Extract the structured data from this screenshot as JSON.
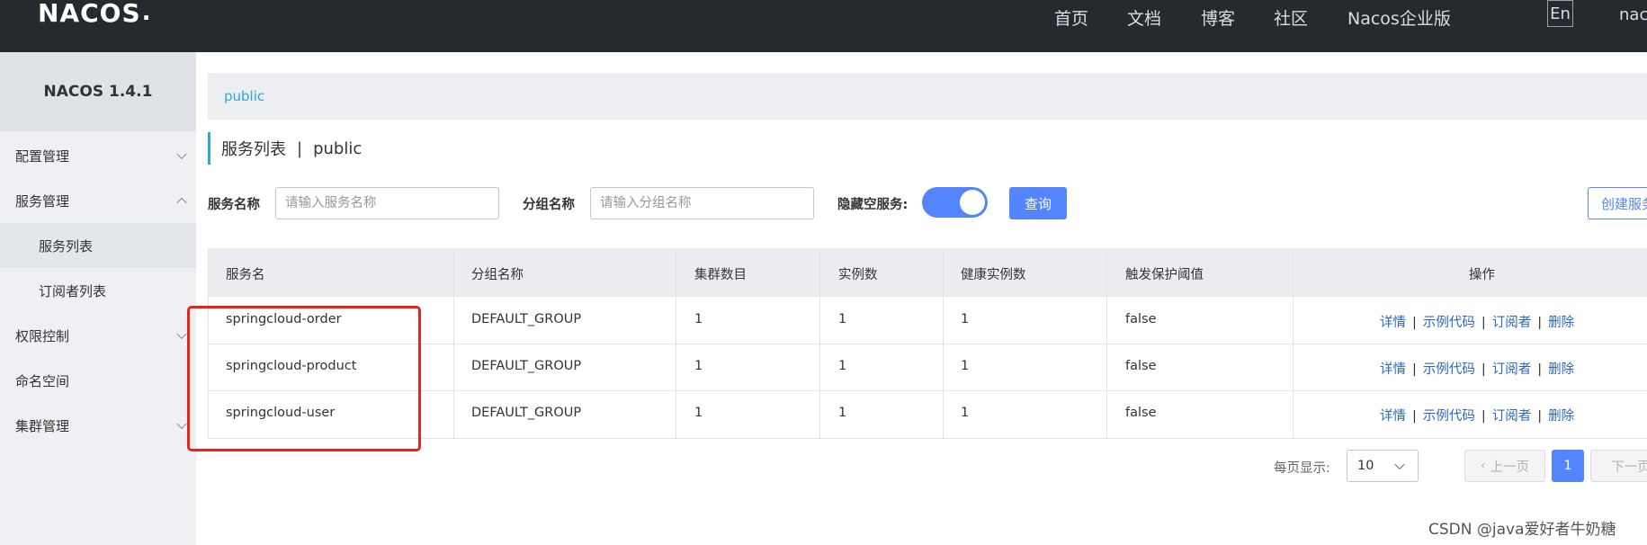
{
  "header": {
    "logo": "NACOS",
    "nav": [
      "首页",
      "文档",
      "博客",
      "社区",
      "Nacos企业版"
    ],
    "lang": "En",
    "user": "nacos"
  },
  "sidebar": {
    "title": "NACOS 1.4.1",
    "items": [
      {
        "label": "配置管理"
      },
      {
        "label": "服务管理"
      },
      {
        "label": "服务列表"
      },
      {
        "label": "订阅者列表"
      },
      {
        "label": "权限控制"
      },
      {
        "label": "命名空间"
      },
      {
        "label": "集群管理"
      }
    ]
  },
  "breadcrumb": {
    "namespace": "public"
  },
  "page_title": {
    "title": "服务列表",
    "sep": "|",
    "namespace": "public"
  },
  "filters": {
    "service_name_label": "服务名称",
    "service_name_placeholder": "请输入服务名称",
    "group_name_label": "分组名称",
    "group_name_placeholder": "请输入分组名称",
    "hide_empty_label": "隐藏空服务:",
    "query_label": "查询",
    "create_label": "创建服务"
  },
  "table": {
    "headers": [
      "服务名",
      "分组名称",
      "集群数目",
      "实例数",
      "健康实例数",
      "触发保护阈值",
      "操作"
    ],
    "rows": [
      {
        "service": "springcloud-order",
        "group": "DEFAULT_GROUP",
        "clusters": "1",
        "instances": "1",
        "healthy": "1",
        "threshold": "false"
      },
      {
        "service": "springcloud-product",
        "group": "DEFAULT_GROUP",
        "clusters": "1",
        "instances": "1",
        "healthy": "1",
        "threshold": "false"
      },
      {
        "service": "springcloud-user",
        "group": "DEFAULT_GROUP",
        "clusters": "1",
        "instances": "1",
        "healthy": "1",
        "threshold": "false"
      }
    ],
    "ops": {
      "detail": "详情",
      "sample": "示例代码",
      "subscribers": "订阅者",
      "delete": "删除",
      "sep": "|"
    }
  },
  "pagination": {
    "per_page_label": "每页显示:",
    "per_page_value": "10",
    "prev_label": "上一页",
    "current": "1",
    "next_label": "下一页"
  },
  "watermark": "CSDN @java爱好者牛奶糖",
  "colors": {
    "accent": "#5584ff",
    "header_bg": "#252a2f",
    "link": "#2a67c9",
    "highlight": "#e3251d"
  }
}
